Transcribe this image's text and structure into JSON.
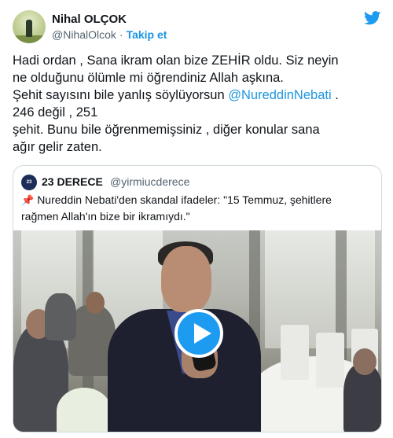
{
  "author": {
    "name": "Nihal OLÇOK",
    "handle": "@NihalOlcok",
    "separator": "·",
    "follow_label": "Takip et"
  },
  "icons": {
    "platform": "twitter-bird-icon",
    "quote_pin": "pushpin-icon",
    "media_play": "play-icon"
  },
  "colors": {
    "link": "#1b95e0",
    "play_button": "#1d9bf0",
    "pin": "#d0021b"
  },
  "tweet": {
    "line1": "Hadi ordan , Sana ikram olan bize ZEHİR oldu. Siz neyin",
    "line2": "ne olduğunu ölümle mi öğrendiniz Allah aşkına.",
    "line3_before": "Şehit sayısını bile yanlış söylüyorsun ",
    "line3_mention": "@NureddinNebati",
    "line3_after": " .",
    "line4": "246 değil , 251",
    "line5": "şehit. Bunu bile öğrenmemişsiniz , diğer konular sana",
    "line6": "ağır gelir zaten."
  },
  "quoted": {
    "avatar_text": "23 DERECE",
    "name": "23 DERECE",
    "handle": "@yirmiucderece",
    "text_line1": "Nureddin Nebati'den skandal ifadeler: \"15 Temmuz, şehitlere",
    "text_line2": "rağmen Allah'ın bize bir ikramıydı.\""
  }
}
